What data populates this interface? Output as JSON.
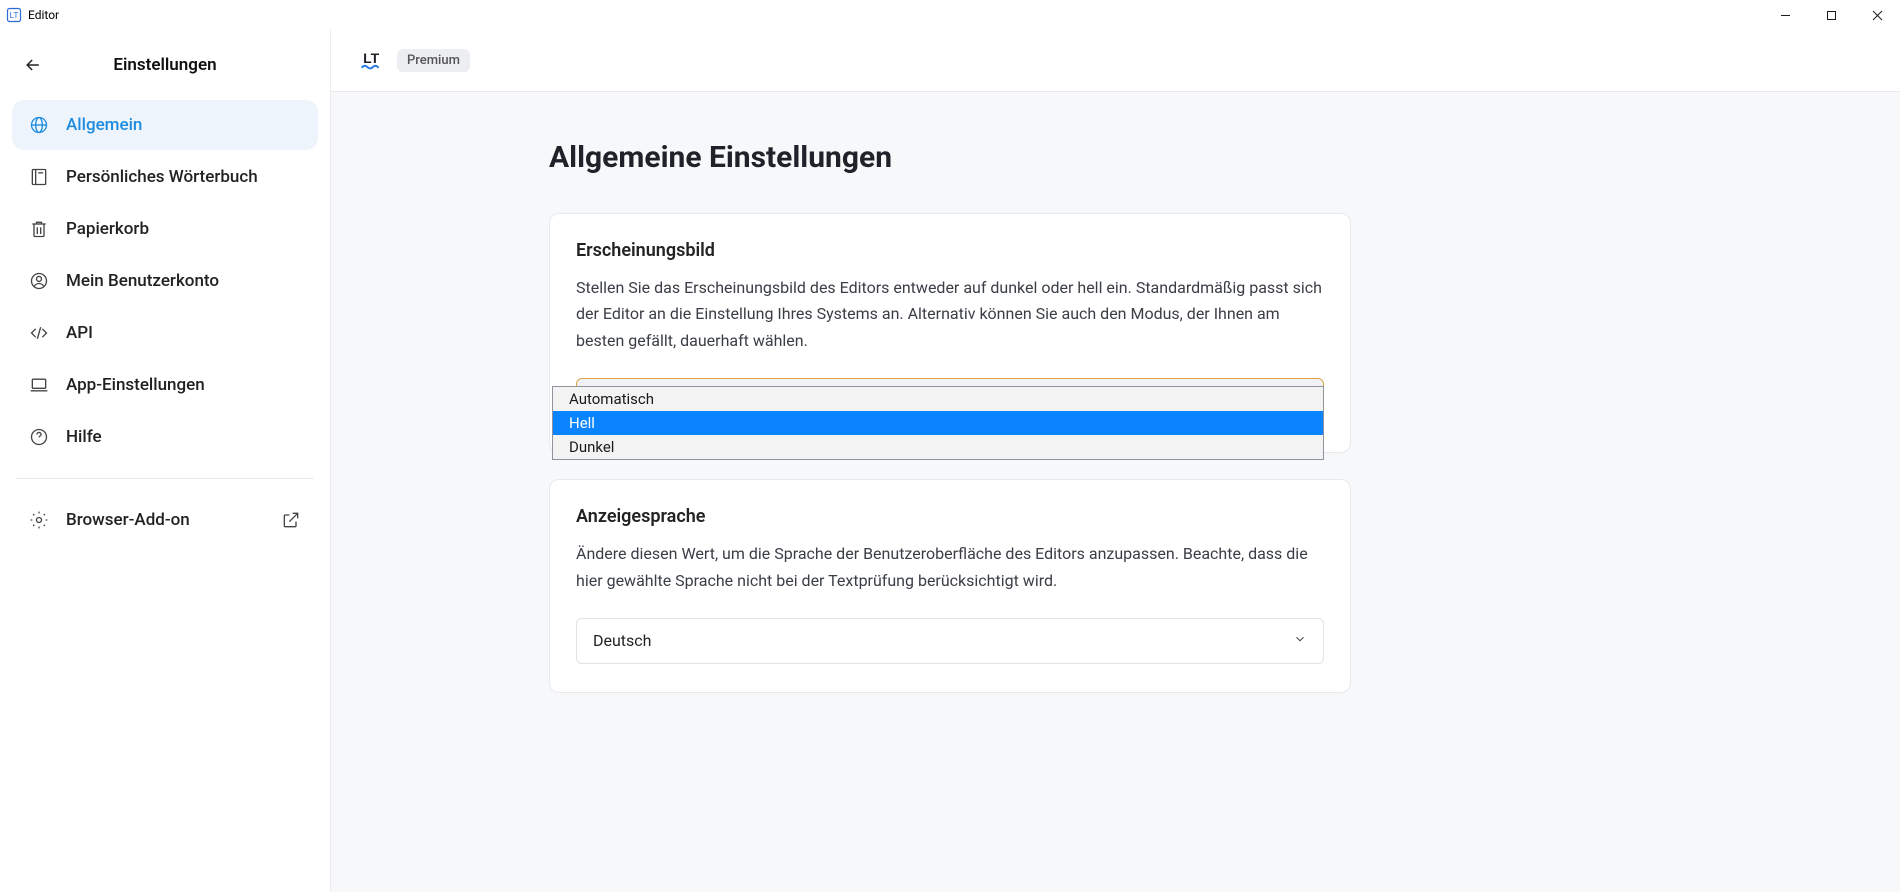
{
  "window": {
    "title": "Editor"
  },
  "sidebar": {
    "title": "Einstellungen",
    "items": {
      "general": "Allgemein",
      "dictionary": "Persönliches Wörterbuch",
      "trash": "Papierkorb",
      "account": "Mein Benutzerkonto",
      "api": "API",
      "appsettings": "App-Einstellungen",
      "help": "Hilfe",
      "addon": "Browser-Add-on"
    }
  },
  "header": {
    "logo": "LT",
    "premium": "Premium"
  },
  "page": {
    "heading": "Allgemeine Einstellungen",
    "appearance": {
      "title": "Erscheinungsbild",
      "desc": "Stellen Sie das Erscheinungsbild des Editors entweder auf dunkel oder hell ein. Standardmäßig passt sich der Editor an die Einstellung Ihres Systems an. Alternativ können Sie auch den Modus, der Ihnen am besten gefällt, dauerhaft wählen.",
      "selected": "Hell",
      "options": {
        "auto": "Automatisch",
        "light": "Hell",
        "dark": "Dunkel"
      }
    },
    "language": {
      "title": "Anzeigesprache",
      "desc": "Ändere diesen Wert, um die Sprache der Benutzeroberfläche des Editors anzupassen. Beachte, dass die hier gewählte Sprache nicht bei der Textprüfung berücksichtigt wird.",
      "selected": "Deutsch"
    }
  }
}
